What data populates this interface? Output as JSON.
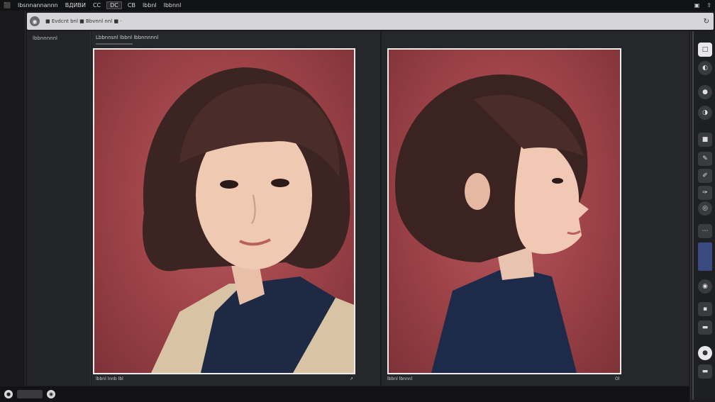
{
  "menubar": {
    "items": [
      "lbsnnannannn",
      "ВДИВИ",
      "CC",
      "DC",
      "CB",
      "lbbnl",
      "lbbnnl"
    ],
    "right_icons": [
      "window-icon",
      "share-icon"
    ]
  },
  "address": {
    "text": "■ Evdcnt bnl ■ Bbvnnl nnl ■ ·",
    "right_icon": "refresh-icon"
  },
  "sidebar": {
    "title": "lbbnnnnnl"
  },
  "workspace": {
    "panel_title": "Lbbnnsnl lbbnl lbbnnnnnl",
    "panel_sub_label": "lbbnnnnl"
  },
  "photos": [
    {
      "caption_left": "lbbnl lnnb lbl",
      "caption_right": "↗"
    },
    {
      "caption_left": "lbbnl lbnnnl",
      "caption_right": "Ol"
    }
  ],
  "tools": [
    "select-tool",
    "brush-tool",
    "eraser-tool",
    "blend-tool",
    "layer-tool",
    "pen-tool",
    "pen-alt-tool",
    "smudge-tool",
    "fill-tool",
    "dots-tool",
    "color-swatch",
    "settings-tool",
    "zoom-tool",
    "minus-tool",
    "circle-tool",
    "tag-tool"
  ],
  "colors": {
    "accent": "#3a4a80",
    "photo_bg": "#9c4247",
    "chrome": "#1c1c1e"
  }
}
